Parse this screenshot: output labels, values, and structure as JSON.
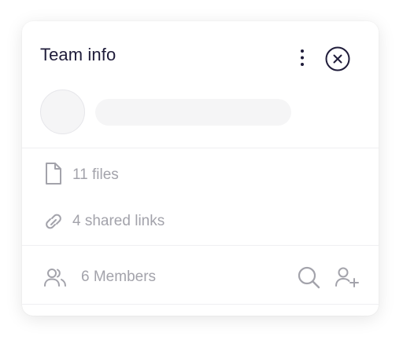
{
  "header": {
    "title": "Team info"
  },
  "items": {
    "files_label": "11 files",
    "links_label": "4 shared links"
  },
  "members": {
    "label": "6 Members"
  },
  "icons": {
    "more": "more-vertical-icon",
    "close": "close-circle-icon",
    "file": "file-icon",
    "link": "link-icon",
    "members": "users-icon",
    "search": "search-icon",
    "add_member": "user-plus-icon"
  },
  "colors": {
    "title": "#1f1c3a",
    "muted_text": "#a3a3ab",
    "icon": "#a3a3ab",
    "skeleton": "#f5f5f6"
  }
}
